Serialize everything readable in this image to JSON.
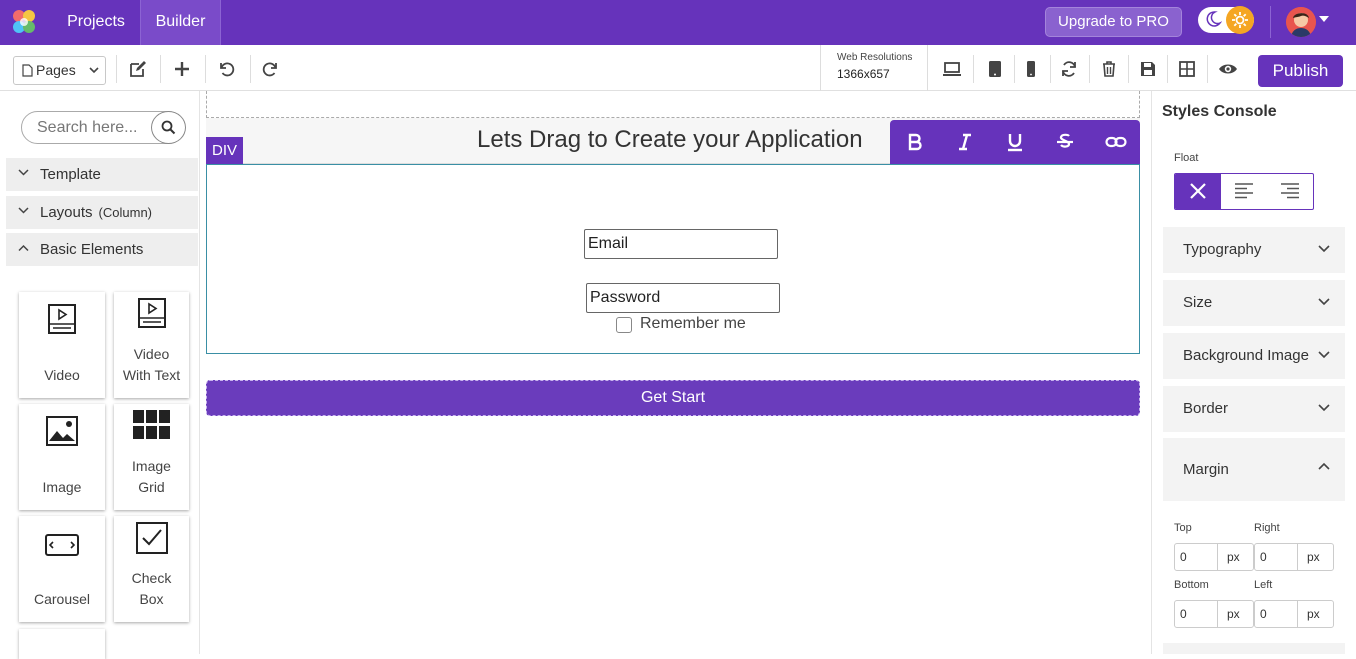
{
  "topbar": {
    "nav": [
      "Projects",
      "Builder"
    ],
    "upgrade_label": "Upgrade to PRO",
    "accent": "#6633bb"
  },
  "toolbar": {
    "pages_label": "Pages",
    "resolution_title": "Web Resolutions",
    "resolution_value": "1366x657",
    "publish_label": "Publish"
  },
  "sidebar": {
    "search_placeholder": "Search here...",
    "sections": [
      {
        "label": "Template",
        "expanded": false
      },
      {
        "label": "Layouts",
        "sub": "(Column)",
        "expanded": false
      },
      {
        "label": "Basic Elements",
        "expanded": true
      }
    ],
    "elements": [
      {
        "label1": "Video",
        "label2": "",
        "icon": "video-icon"
      },
      {
        "label1": "Video",
        "label2": "With Text",
        "icon": "video-with-text-icon"
      },
      {
        "label1": "Image",
        "label2": "",
        "icon": "image-icon"
      },
      {
        "label1": "Image",
        "label2": "Grid",
        "icon": "image-grid-icon"
      },
      {
        "label1": "Carousel",
        "label2": "",
        "icon": "carousel-icon"
      },
      {
        "label1": "Check",
        "label2": "Box",
        "icon": "checkbox-icon"
      }
    ]
  },
  "canvas": {
    "headline": "Lets Drag to Create your Application",
    "div_tag": "DIV",
    "email_value": "Email",
    "password_value": "Password",
    "remember_label": "Remember me",
    "button_label": "Get Start"
  },
  "styles_console": {
    "title": "Styles Console",
    "float_label": "Float",
    "sections": [
      "Typography",
      "Size",
      "Background Image",
      "Border",
      "Margin"
    ],
    "margin": {
      "top_label": "Top",
      "right_label": "Right",
      "bottom_label": "Bottom",
      "left_label": "Left",
      "top": "0",
      "right": "0",
      "bottom": "0",
      "left": "0",
      "unit": "px"
    }
  }
}
